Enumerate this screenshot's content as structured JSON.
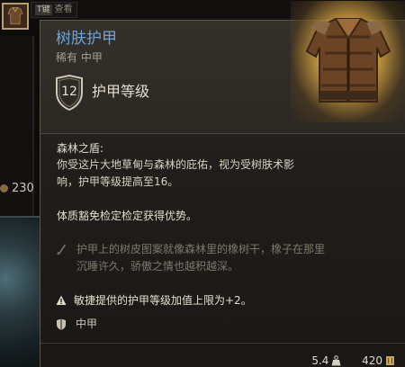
{
  "background": {
    "tab_key": "T键",
    "tab_label": "查看",
    "side_number": "230"
  },
  "item": {
    "title": "树肤护甲",
    "subtitle": "稀有 中甲",
    "armor_class_value": "12",
    "armor_class_label": "护甲等级",
    "rarity_color": "#69a5da",
    "image_icon": "leather-armor-icon"
  },
  "passive": {
    "name": "森林之盾:",
    "description_lines": [
      "你受这片大地草甸与森林的庇佑，视为受树肤术影",
      "响，护甲等级提高至16。"
    ],
    "save_advantage": "体质豁免检定检定获得优势。"
  },
  "flavor": {
    "icon": "quill-icon",
    "lines": [
      "护甲上的树皮图案就像森林里的橡树干，橡子在那里",
      "沉睡许久，骄傲之情也越积越深。"
    ]
  },
  "warning": {
    "icon": "warning-icon",
    "text": "敏捷提供的护甲等级加值上限为+2。"
  },
  "armor_type": {
    "icon": "armor-type-icon",
    "text": "中甲"
  },
  "footer": {
    "weight": "5.4",
    "weight_icon": "weight-icon",
    "price": "420",
    "price_icon": "gold-coin-icon"
  }
}
